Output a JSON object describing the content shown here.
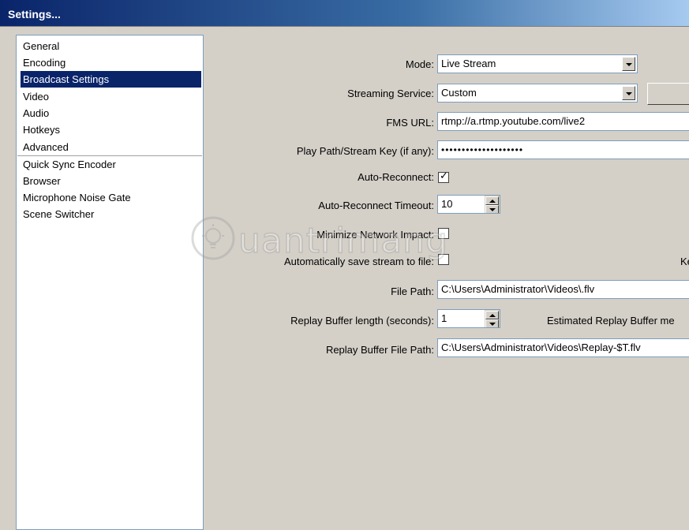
{
  "window": {
    "title": "Settings..."
  },
  "sidebar": {
    "items": [
      {
        "label": "General"
      },
      {
        "label": "Encoding"
      },
      {
        "label": "Broadcast Settings",
        "selected": true
      },
      {
        "label": "Video"
      },
      {
        "label": "Audio"
      },
      {
        "label": "Hotkeys"
      },
      {
        "label": "Advanced"
      },
      {
        "label": "Quick Sync Encoder"
      },
      {
        "label": "Browser"
      },
      {
        "label": "Microphone Noise Gate"
      },
      {
        "label": "Scene Switcher"
      }
    ]
  },
  "form": {
    "mode": {
      "label": "Mode:",
      "value": "Live Stream"
    },
    "streaming_service": {
      "label": "Streaming Service:",
      "value": "Custom"
    },
    "fms_url": {
      "label": "FMS URL:",
      "value": "rtmp://a.rtmp.youtube.com/live2"
    },
    "stream_key": {
      "label": "Play Path/Stream Key (if any):",
      "value": "••••••••••••••••••••"
    },
    "auto_reconnect": {
      "label": "Auto-Reconnect:",
      "checked": true
    },
    "auto_reconnect_timeout": {
      "label": "Auto-Reconnect Timeout:",
      "value": "10"
    },
    "minimize_network_impact": {
      "label": "Minimize Network Impact:",
      "checked": false
    },
    "auto_save_stream": {
      "label": "Automatically save stream to file:",
      "checked": false,
      "right_text": "Ke"
    },
    "file_path": {
      "label": "File Path:",
      "value": "C:\\Users\\Administrator\\Videos\\.flv"
    },
    "replay_buffer_length": {
      "label": "Replay Buffer length (seconds):",
      "value": "1",
      "right_text": "Estimated Replay Buffer me"
    },
    "replay_buffer_file_path": {
      "label": "Replay Buffer File Path:",
      "value": "C:\\Users\\Administrator\\Videos\\Replay-$T.flv"
    }
  },
  "watermark": {
    "text": "uantrimang"
  },
  "icons": {
    "combo": "chevron-down-icon",
    "checkbox_check": "checkmark-icon",
    "spin_up": "arrow-up-icon",
    "spin_down": "arrow-down-icon",
    "watermark_logo": "lightbulb-logo"
  },
  "colors": {
    "window_bg": "#d4d0c8",
    "title_bar": "#0a246a",
    "selection": "#0a246a"
  }
}
